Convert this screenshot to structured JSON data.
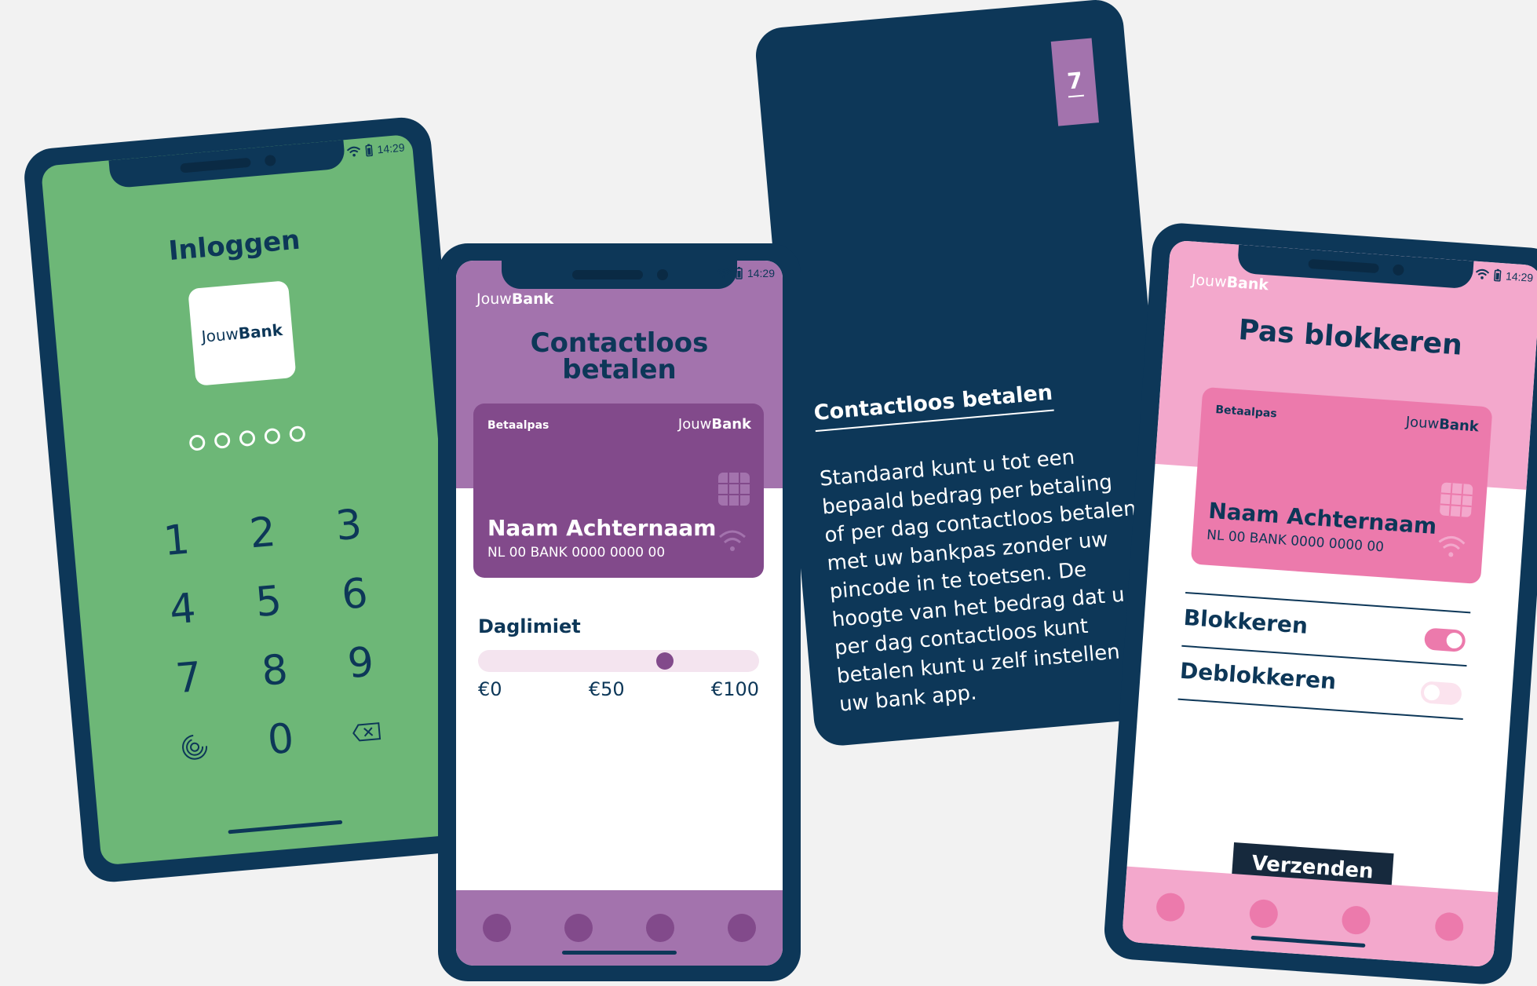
{
  "colors": {
    "navy": "#0d3758",
    "green": "#6db777",
    "purple": "#a373ad",
    "purple_dark": "#824a8b",
    "pink": "#f3a8cc",
    "pink_dark": "#ec7aac",
    "background": "#f2f2f2"
  },
  "status": {
    "time": "14:29",
    "wifi_icon": "wifi-icon",
    "battery_icon": "battery-icon"
  },
  "login_screen": {
    "title": "Inloggen",
    "logo": {
      "light": "Jouw",
      "bold": "Bank"
    },
    "pin_length": 5,
    "keys": [
      "1",
      "2",
      "3",
      "4",
      "5",
      "6",
      "7",
      "8",
      "9",
      "0"
    ],
    "fingerprint_icon": "fingerprint-icon",
    "delete_icon": "backspace-icon"
  },
  "contactless_screen": {
    "brand": {
      "light": "Jouw",
      "bold": "Bank"
    },
    "title_line1": "Contactloos",
    "title_line2": "betalen",
    "card": {
      "type": "Betaalpas",
      "brand_light": "Jouw",
      "brand_bold": "Bank",
      "name": "Naam Achternaam",
      "number": "NL 00 BANK 0000 0000 00"
    },
    "daily_limit": {
      "label": "Daglimiet",
      "min_label": "€0",
      "mid_label": "€50",
      "max_label": "€100",
      "value_fraction": 0.68
    },
    "nav_items": 4
  },
  "info_card": {
    "number": "7",
    "title": "Contactloos betalen",
    "body": "Standaard kunt u tot een bepaald bedrag per betaling of per dag contactloos betalen met uw bankpas zonder uw pincode in te toetsen. De hoogte van het bedrag dat u per dag contactloos kunt betalen kunt u zelf instellen in uw bank app."
  },
  "block_screen": {
    "brand": {
      "light": "Jouw",
      "bold": "Bank"
    },
    "title": "Pas blokkeren",
    "card": {
      "type": "Betaalpas",
      "brand_light": "Jouw",
      "brand_bold": "Bank",
      "name": "Naam Achternaam",
      "number": "NL 00 BANK 0000 0000 00"
    },
    "toggles": [
      {
        "label": "Blokkeren",
        "on": true
      },
      {
        "label": "Deblokkeren",
        "on": false
      }
    ],
    "submit_label": "Verzenden",
    "nav_items": 4
  }
}
